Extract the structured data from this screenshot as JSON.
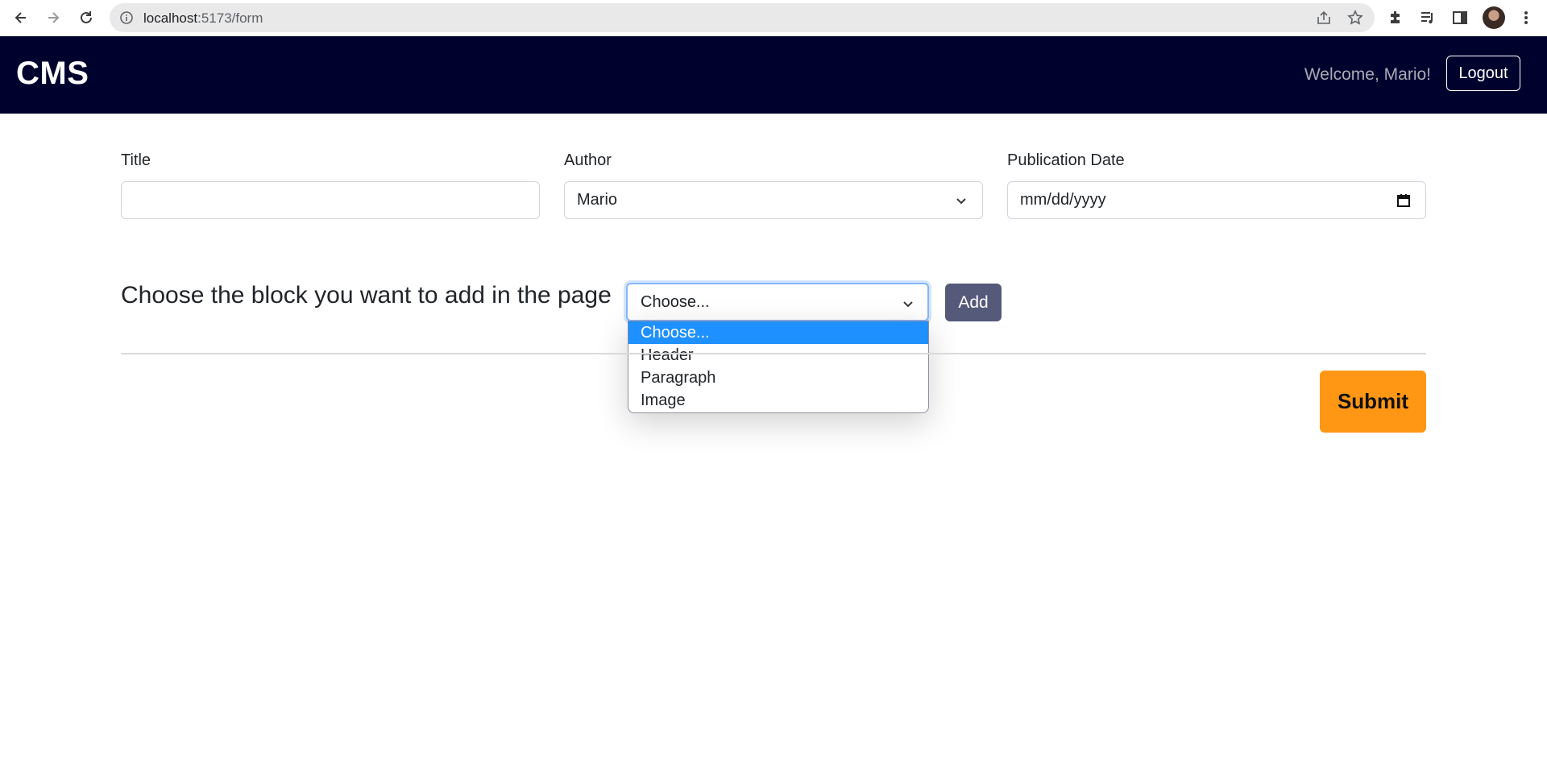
{
  "browser": {
    "url_host": "localhost",
    "url_rest": ":5173/form"
  },
  "app": {
    "brand": "CMS",
    "welcome": "Welcome, Mario!",
    "logout_label": "Logout"
  },
  "form": {
    "title_label": "Title",
    "title_value": "",
    "author_label": "Author",
    "author_value": "Mario",
    "date_label": "Publication Date",
    "date_placeholder": "mm/dd/yyyy"
  },
  "block": {
    "prompt": "Choose the block you want to add in the page",
    "selected": "Choose...",
    "options": [
      "Choose...",
      "Header",
      "Paragraph",
      "Image"
    ],
    "highlighted_index": 0,
    "add_label": "Add"
  },
  "submit_label": "Submit",
  "colors": {
    "navbar": "#00022e",
    "add_button": "#55597a",
    "submit_button": "#ff9614",
    "option_highlight": "#1e90ff"
  }
}
